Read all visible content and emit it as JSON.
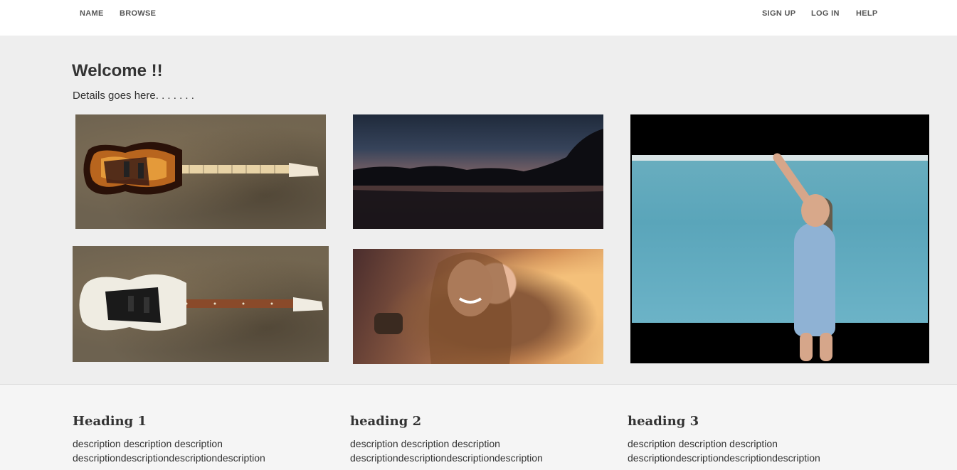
{
  "nav": {
    "left": [
      "NAME",
      "BROWSE"
    ],
    "right": [
      "SIGN UP",
      "LOG IN",
      "HELP"
    ]
  },
  "hero": {
    "title": "Welcome !!",
    "subtitle": "Details goes here. . . . . . .",
    "images": [
      {
        "name": "sunburst-bass-guitar-image"
      },
      {
        "name": "white-bass-guitar-image"
      },
      {
        "name": "sunset-lake-image"
      },
      {
        "name": "smiling-woman-image"
      },
      {
        "name": "pool-video"
      }
    ]
  },
  "features": [
    {
      "heading": "Heading 1",
      "line1": "description description description",
      "line2": "descriptiondescriptiondescriptiondescription"
    },
    {
      "heading": "heading 2",
      "line1": "description description description",
      "line2": "descriptiondescriptiondescriptiondescription"
    },
    {
      "heading": "heading 3",
      "line1": "description description description",
      "line2": "descriptiondescriptiondescriptiondescription"
    }
  ],
  "colors": {
    "nav_bg": "#ffffff",
    "hero_bg": "#eeeeee",
    "page_bg": "#f5f5f5",
    "text": "#333333"
  }
}
